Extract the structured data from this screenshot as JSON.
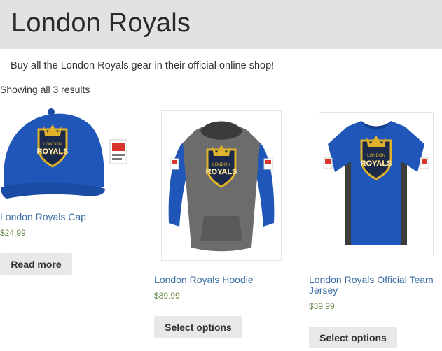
{
  "page": {
    "title": "London Royals",
    "intro": "Buy all the London Royals gear in their official online shop!",
    "result_count": "Showing all 3 results"
  },
  "products": [
    {
      "name": "London Royals Cap",
      "price": "$24.99",
      "button_label": "Read more",
      "image": "cap-image",
      "shield_text": [
        "LONDON",
        "ROYALS"
      ]
    },
    {
      "name": "London Royals Hoodie",
      "price": "$89.99",
      "button_label": "Select options",
      "image": "hoodie-image",
      "shield_text": [
        "LONDON",
        "ROYALS"
      ]
    },
    {
      "name": "London Royals Official Team Jersey",
      "price": "$39.99",
      "button_label": "Select options",
      "image": "jersey-image",
      "shield_text": [
        "LONDON",
        "ROYALS"
      ]
    }
  ],
  "colors": {
    "header_bg": "#e2e2e2",
    "link": "#3a6ea5",
    "price": "#6a8a4a",
    "button_bg": "#e8e8e8",
    "royal_blue": "#1f56b8",
    "logo_gold": "#e0b12a"
  }
}
